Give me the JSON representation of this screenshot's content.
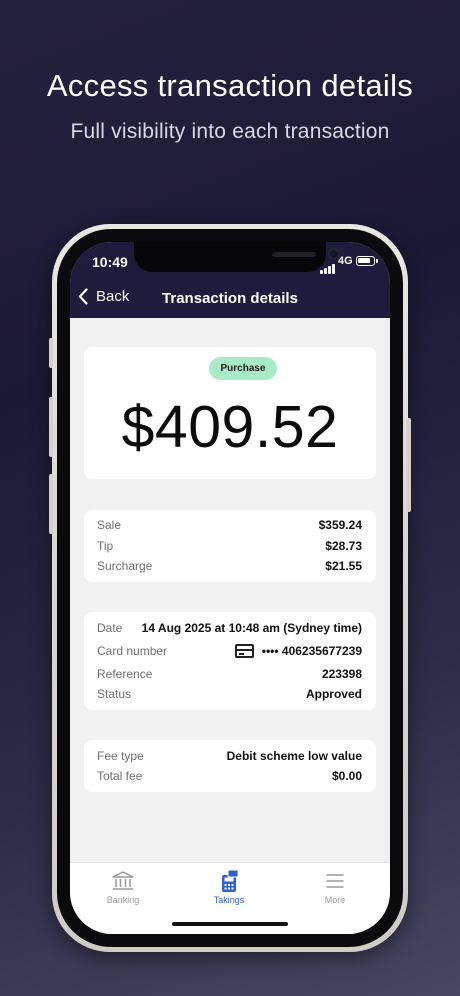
{
  "headline": "Access transaction details",
  "subline": "Full visibility into each transaction",
  "status_bar": {
    "time": "10:49",
    "network": "4G"
  },
  "nav": {
    "back_label": "Back",
    "title": "Transaction details"
  },
  "transaction": {
    "badge": "Purchase",
    "amount": "$409.52"
  },
  "breakdown": [
    {
      "label": "Sale",
      "value": "$359.24"
    },
    {
      "label": "Tip",
      "value": "$28.73"
    },
    {
      "label": "Surcharge",
      "value": "$21.55"
    }
  ],
  "details": {
    "date_label": "Date",
    "date_value": "14 Aug 2025 at 10:48 am (Sydney time)",
    "card_label": "Card number",
    "card_value": "•••• 406235677239",
    "reference_label": "Reference",
    "reference_value": "223398",
    "status_label": "Status",
    "status_value": "Approved"
  },
  "fees": {
    "fee_type_label": "Fee type",
    "fee_type_value": "Debit scheme low value",
    "total_fee_label": "Total fee",
    "total_fee_value": "$0.00"
  },
  "tabs": [
    {
      "label": "Banking",
      "icon": "bank-icon",
      "active": false
    },
    {
      "label": "Takings",
      "icon": "terminal-icon",
      "active": true
    },
    {
      "label": "More",
      "icon": "menu-icon",
      "active": false
    }
  ],
  "colors": {
    "header_bg": "#1e1b3d",
    "badge_bg": "#a7ecc6",
    "active_tab": "#2f5fd6",
    "inactive_tab": "#9a9a9a"
  }
}
